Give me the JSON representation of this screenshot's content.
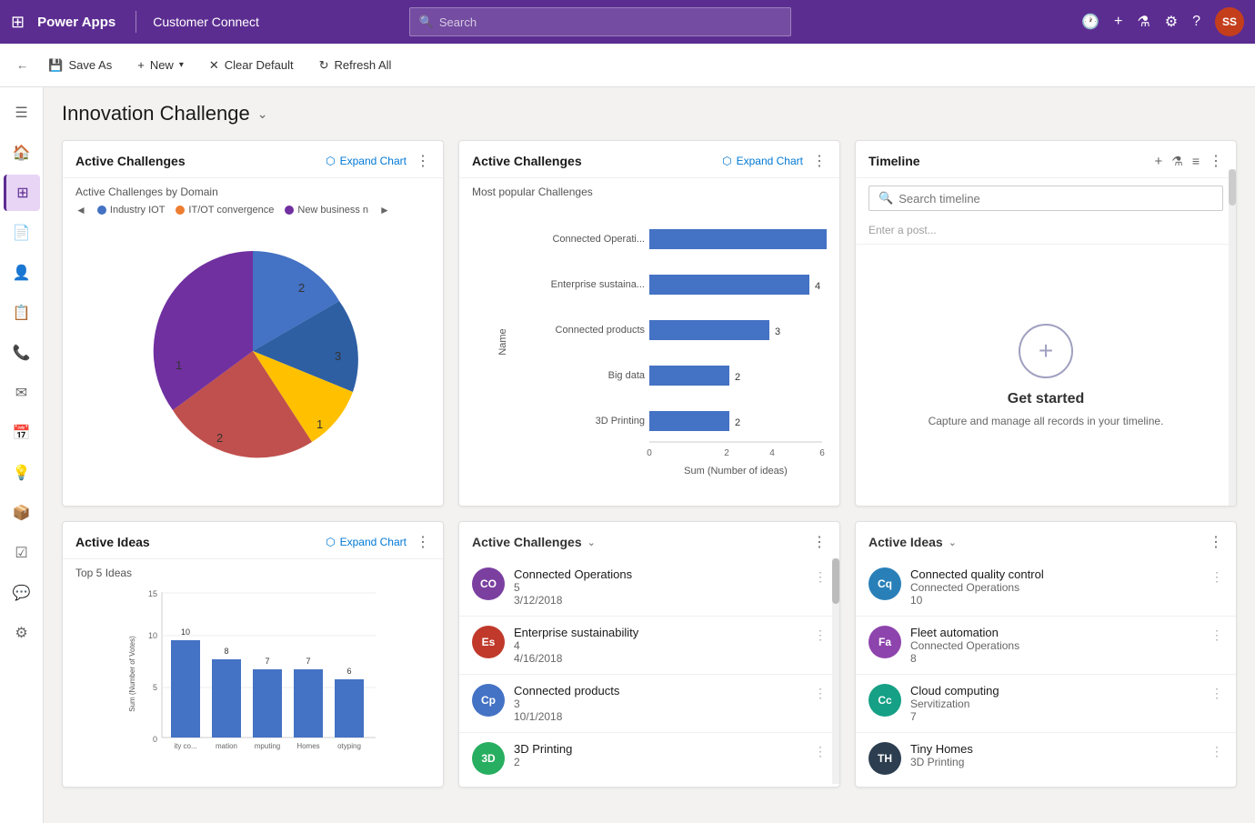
{
  "topNav": {
    "appName": "Power Apps",
    "moduleName": "Customer Connect",
    "searchPlaceholder": "Search",
    "userInitials": "SS"
  },
  "toolbar": {
    "back": "←",
    "saveAs": "Save As",
    "new": "New",
    "clearDefault": "Clear Default",
    "refreshAll": "Refresh All"
  },
  "pageTitle": "Innovation Challenge",
  "sidebar": {
    "items": [
      {
        "label": "menu",
        "icon": "☰"
      },
      {
        "label": "home",
        "icon": "🏠"
      },
      {
        "label": "dashboard",
        "icon": "⊞",
        "active": true
      },
      {
        "label": "pages",
        "icon": "📄"
      },
      {
        "label": "contacts",
        "icon": "👤"
      },
      {
        "label": "activities",
        "icon": "📋"
      },
      {
        "label": "calls",
        "icon": "📞"
      },
      {
        "label": "mail",
        "icon": "✉"
      },
      {
        "label": "calendar",
        "icon": "📅"
      },
      {
        "label": "insights",
        "icon": "💡"
      },
      {
        "label": "products",
        "icon": "📦"
      },
      {
        "label": "tasks",
        "icon": "☑"
      },
      {
        "label": "chat",
        "icon": "💬"
      },
      {
        "label": "settings",
        "icon": "⚙"
      }
    ]
  },
  "card1": {
    "title": "Active Challenges",
    "expandLabel": "Expand Chart",
    "chartSubtitle": "Active Challenges by Domain",
    "legendItems": [
      {
        "label": "Industry IOT",
        "color": "#4472c4"
      },
      {
        "label": "IT/OT convergence",
        "color": "#ed7d31"
      },
      {
        "label": "New business n",
        "color": "#7030a0"
      }
    ],
    "pieSections": [
      {
        "label": "2",
        "value": 2,
        "color": "#4472c4",
        "startAngle": 0,
        "endAngle": 120
      },
      {
        "label": "3",
        "value": 3,
        "color": "#2e5fa3",
        "startAngle": 120,
        "endAngle": 216
      },
      {
        "label": "1",
        "value": 1,
        "color": "#ffc000",
        "startAngle": 216,
        "endAngle": 252
      },
      {
        "label": "2",
        "value": 2,
        "color": "#c0504d",
        "startAngle": 252,
        "endAngle": 324
      },
      {
        "label": "1",
        "value": 1,
        "color": "#7030a0",
        "startAngle": 324,
        "endAngle": 360
      }
    ]
  },
  "card2": {
    "title": "Active Challenges",
    "expandLabel": "Expand Chart",
    "chartSubtitle": "Most popular Challenges",
    "xAxisLabel": "Sum (Number of ideas)",
    "yAxisLabel": "Name",
    "bars": [
      {
        "label": "Connected Operati...",
        "value": 5,
        "maxValue": 6
      },
      {
        "label": "Enterprise sustaina...",
        "value": 4,
        "maxValue": 6
      },
      {
        "label": "Connected products",
        "value": 3,
        "maxValue": 6
      },
      {
        "label": "Big data",
        "value": 2,
        "maxValue": 6
      },
      {
        "label": "3D Printing",
        "value": 2,
        "maxValue": 6
      }
    ],
    "xTicks": [
      0,
      2,
      4,
      6
    ]
  },
  "card3": {
    "title": "Timeline",
    "searchPlaceholder": "Search timeline",
    "postPlaceholder": "Enter a post...",
    "emptyTitle": "Get started",
    "emptySub": "Capture and manage all records in your timeline."
  },
  "card4": {
    "title": "Active Ideas",
    "expandLabel": "Expand Chart",
    "chartTitle": "Top 5 Ideas",
    "yAxisLabel": "Sum (Number of Votes)",
    "bars": [
      {
        "label": "ity co...",
        "value": 10,
        "maxValue": 15
      },
      {
        "label": "mation",
        "value": 8,
        "maxValue": 15
      },
      {
        "label": "mputing",
        "value": 7,
        "maxValue": 15
      },
      {
        "label": "Homes",
        "value": 7,
        "maxValue": 15
      },
      {
        "label": "otyping",
        "value": 6,
        "maxValue": 15
      }
    ],
    "yTicks": [
      0,
      5,
      10,
      15
    ]
  },
  "card5": {
    "title": "Active Challenges",
    "items": [
      {
        "initials": "CO",
        "color": "#7b3fa0",
        "title": "Connected Operations",
        "sub1": "5",
        "sub2": "3/12/2018"
      },
      {
        "initials": "Es",
        "color": "#c0392b",
        "title": "Enterprise sustainability",
        "sub1": "4",
        "sub2": "4/16/2018"
      },
      {
        "initials": "Cp",
        "color": "#4472c4",
        "title": "Connected products",
        "sub1": "3",
        "sub2": "10/1/2018"
      },
      {
        "initials": "3D",
        "color": "#27ae60",
        "title": "3D Printing",
        "sub1": "2",
        "sub2": ""
      }
    ]
  },
  "card6": {
    "title": "Active Ideas",
    "items": [
      {
        "initials": "Cq",
        "color": "#2980b9",
        "title": "Connected quality control",
        "sub1": "Connected Operations",
        "sub2": "10"
      },
      {
        "initials": "Fa",
        "color": "#8e44ad",
        "title": "Fleet automation",
        "sub1": "Connected Operations",
        "sub2": "8"
      },
      {
        "initials": "Cc",
        "color": "#16a085",
        "title": "Cloud computing",
        "sub1": "Servitization",
        "sub2": "7"
      },
      {
        "initials": "TH",
        "color": "#2c3e50",
        "title": "Tiny Homes",
        "sub1": "3D Printing",
        "sub2": ""
      }
    ]
  }
}
